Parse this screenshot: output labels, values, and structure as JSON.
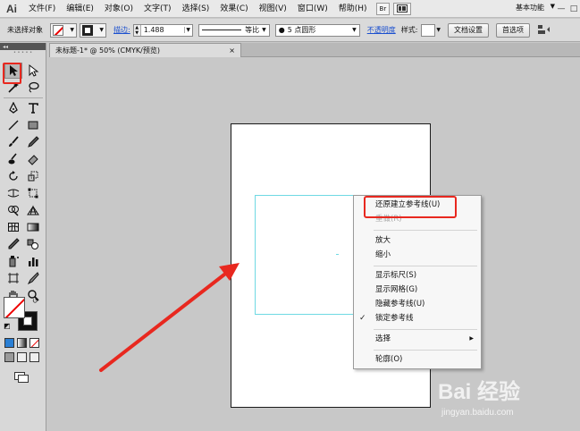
{
  "app": {
    "logo": "Ai"
  },
  "menubar": {
    "items": [
      "文件(F)",
      "编辑(E)",
      "对象(O)",
      "文字(T)",
      "选择(S)",
      "效果(C)",
      "视图(V)",
      "窗口(W)",
      "帮助(H)"
    ],
    "bridge_label": "Br",
    "workspace": "基本功能"
  },
  "controlbar": {
    "selection_status": "未选择对象",
    "stroke_label": "描边:",
    "stroke_weight": "1.488",
    "profile_label": "等比",
    "brush_label": "5 点圆形",
    "opacity_label": "不透明度",
    "style_label": "样式:",
    "doc_settings_label": "文档设置",
    "preferences_label": "首选项"
  },
  "document": {
    "tab_title": "未标题-1* @ 50% (CMYK/预览)",
    "close_glyph": "×"
  },
  "context_menu": {
    "items": [
      {
        "label": "还原建立参考线(U)",
        "disabled": false
      },
      {
        "label": "重做(R)",
        "disabled": true
      },
      {
        "label": "放大",
        "disabled": false
      },
      {
        "label": "缩小",
        "disabled": false
      },
      {
        "label": "显示标尺(S)",
        "disabled": false
      },
      {
        "label": "显示网格(G)",
        "disabled": false
      },
      {
        "label": "隐藏参考线(U)",
        "disabled": false
      },
      {
        "label": "锁定参考线",
        "disabled": false,
        "checked": true
      },
      {
        "label": "选择",
        "disabled": false,
        "submenu": true
      },
      {
        "label": "轮廓(O)",
        "disabled": false
      }
    ],
    "check_glyph": "✓",
    "submenu_glyph": "▶"
  },
  "annotations": {
    "highlight_color": "#e8281f",
    "arrow_color": "#e8281f"
  },
  "colors": {
    "guide": "#6fd9e3",
    "link": "#1a4fcf",
    "canvas_bg": "#c8c8c8"
  },
  "watermark": {
    "brand": "Bai 经验",
    "url": "jingyan.baidu.com"
  }
}
